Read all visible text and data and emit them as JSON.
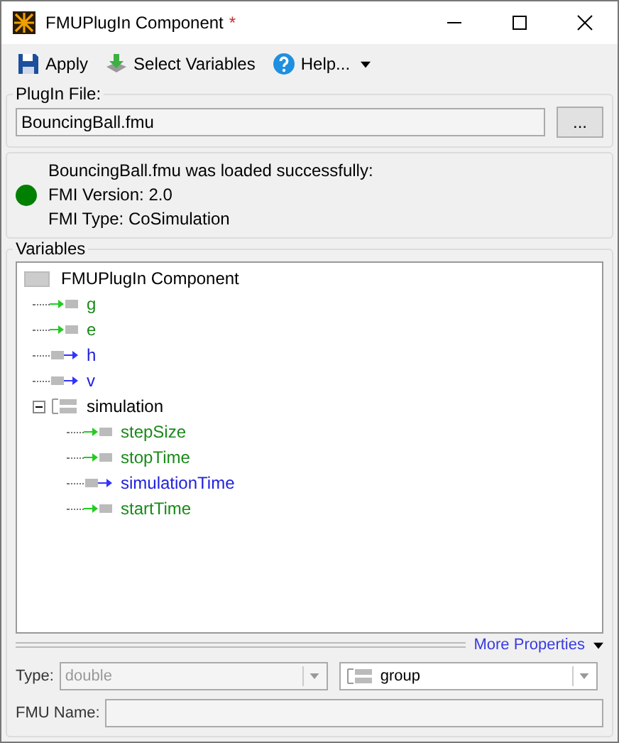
{
  "window": {
    "title": "FMUPlugIn Component",
    "modified_mark": "*"
  },
  "toolbar": [
    {
      "kind": "save",
      "label": "Apply"
    },
    {
      "kind": "download",
      "label": "Select Variables"
    },
    {
      "kind": "help",
      "label": "Help...",
      "dropdown": true
    }
  ],
  "plugin_file": {
    "label": "PlugIn File:",
    "value": "BouncingBall.fmu",
    "browse": "..."
  },
  "status": {
    "color": "#008000",
    "lines": [
      "BouncingBall.fmu was loaded successfully:",
      "FMI Version: 2.0",
      "FMI Type: CoSimulation"
    ]
  },
  "variables": {
    "label": "Variables",
    "root": "FMUPlugIn Component",
    "items": [
      {
        "kind": "input",
        "label": "g"
      },
      {
        "kind": "input",
        "label": "e"
      },
      {
        "kind": "output",
        "label": "h"
      },
      {
        "kind": "output",
        "label": "v"
      },
      {
        "kind": "group",
        "label": "simulation",
        "expanded": true,
        "children": [
          {
            "kind": "input",
            "label": "stepSize"
          },
          {
            "kind": "input",
            "label": "stopTime"
          },
          {
            "kind": "output",
            "label": "simulationTime"
          },
          {
            "kind": "input",
            "label": "startTime"
          }
        ]
      }
    ]
  },
  "more_properties": "More Properties",
  "type_field": {
    "label": "Type:",
    "value": "double",
    "disabled": true
  },
  "kind_field": {
    "value": "group"
  },
  "fmu_name": {
    "label": "FMU Name:"
  }
}
